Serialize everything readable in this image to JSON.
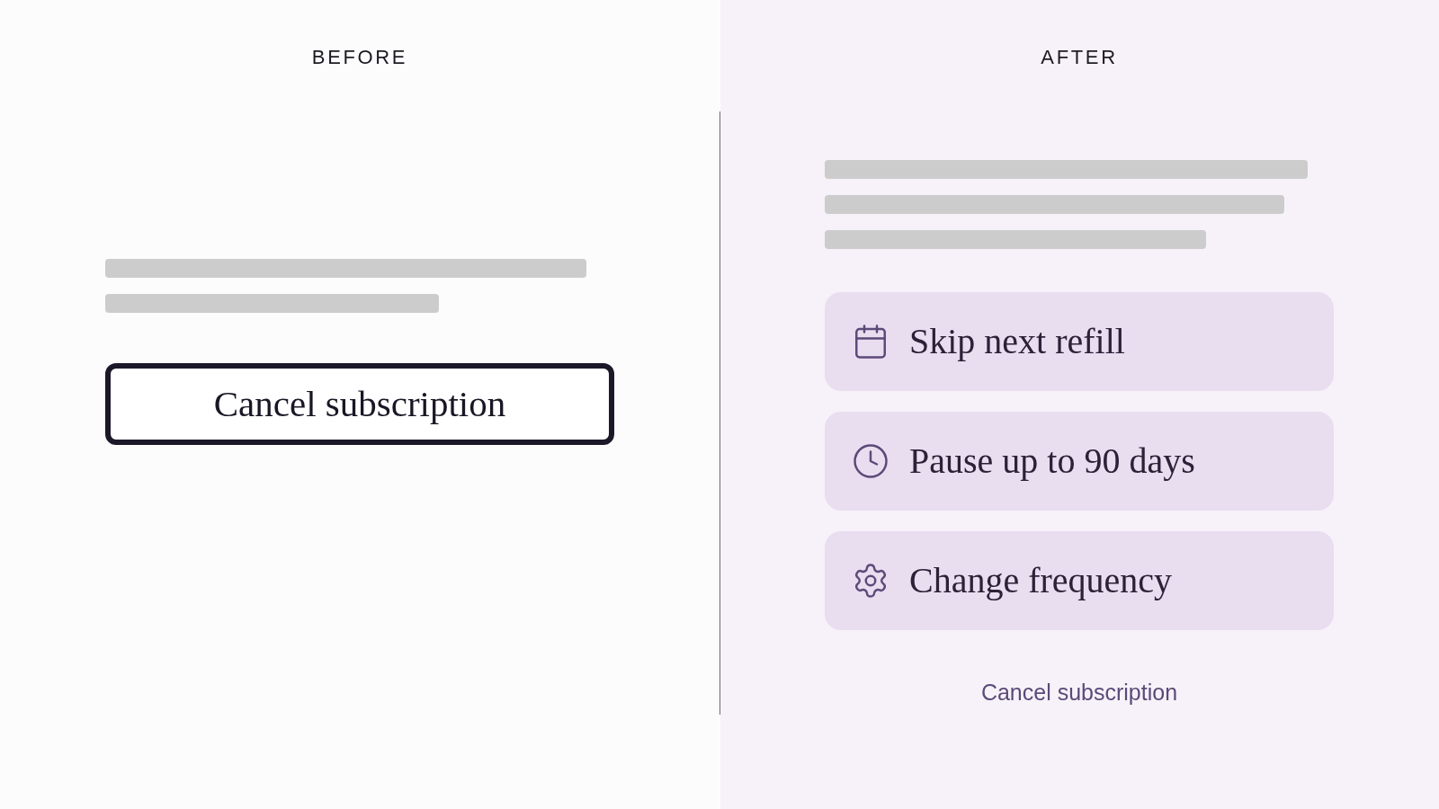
{
  "before": {
    "heading": "BEFORE",
    "cancel_button": "Cancel subscription"
  },
  "after": {
    "heading": "AFTER",
    "options": [
      {
        "label": "Skip next refill"
      },
      {
        "label": "Pause up to 90 days"
      },
      {
        "label": "Change frequency"
      }
    ],
    "cancel_link": "Cancel subscription"
  }
}
